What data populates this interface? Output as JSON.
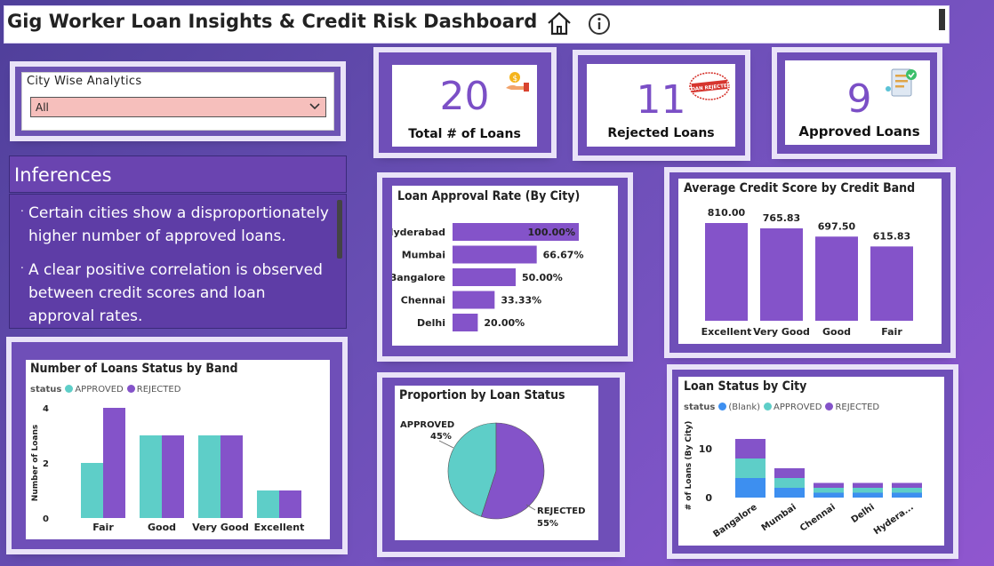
{
  "header": {
    "title": "Gig Worker Loan Insights & Credit Risk Dashboard"
  },
  "filter": {
    "label": "City Wise Analytics",
    "selected": "All"
  },
  "inferences": {
    "title": "Inferences",
    "items": [
      "Certain cities show a disproportionately higher number of approved loans.",
      "A clear positive correlation is observed between credit scores and loan approval rates."
    ]
  },
  "kpis": [
    {
      "value": "20",
      "label": "Total # of Loans",
      "icon": "money-hand-icon"
    },
    {
      "value": "11",
      "label": "Rejected Loans",
      "icon": "loan-rejected-stamp-icon",
      "stamp_text": "LOAN REJECTED"
    },
    {
      "value": "9",
      "label": "Approved Loans",
      "icon": "approved-document-icon"
    }
  ],
  "colors": {
    "purple": "#8453c9",
    "teal": "#5ecec8",
    "blue": "#3d8ff0"
  },
  "chart_data": [
    {
      "type": "bar",
      "orientation": "horizontal",
      "title": "Loan Approval Rate (By City)",
      "categories": [
        "Hyderabad",
        "Mumbai",
        "Bangalore",
        "Chennai",
        "Delhi"
      ],
      "values": [
        100.0,
        66.67,
        50.0,
        33.33,
        20.0
      ],
      "labels": [
        "100.00%",
        "66.67%",
        "50.00%",
        "33.33%",
        "20.00%"
      ]
    },
    {
      "type": "bar",
      "title": "Average Credit Score by Credit Band",
      "categories": [
        "Excellent",
        "Very Good",
        "Good",
        "Fair"
      ],
      "values": [
        810.0,
        765.83,
        697.5,
        615.83
      ],
      "labels": [
        "810.00",
        "765.83",
        "697.50",
        "615.83"
      ]
    },
    {
      "type": "bar",
      "title": "Number of Loans Status by Band",
      "legend_title": "status",
      "ylabel": "Number of Loans",
      "yticks": [
        "0",
        "2",
        "4"
      ],
      "ylim": [
        0,
        4
      ],
      "categories": [
        "Fair",
        "Good",
        "Very Good",
        "Excellent"
      ],
      "series": [
        {
          "name": "APPROVED",
          "values": [
            2,
            3,
            3,
            1
          ]
        },
        {
          "name": "REJECTED",
          "values": [
            4,
            3,
            3,
            1
          ]
        }
      ]
    },
    {
      "type": "pie",
      "title": "Proportion by Loan Status",
      "slices": [
        {
          "name": "APPROVED",
          "value": 45,
          "label": "45%"
        },
        {
          "name": "REJECTED",
          "value": 55,
          "label": "55%"
        }
      ]
    },
    {
      "type": "bar",
      "stacked": true,
      "title": "Loan Status by City",
      "legend_title": "status",
      "ylabel": "# of Loans (By City)",
      "yticks": [
        "0",
        "10"
      ],
      "categories": [
        "Bangalore",
        "Mumbai",
        "Chennai",
        "Delhi",
        "Hydera..."
      ],
      "series": [
        {
          "name": "(Blank)",
          "values": [
            4,
            2,
            1,
            1,
            1
          ]
        },
        {
          "name": "APPROVED",
          "values": [
            4,
            2,
            1,
            1,
            1
          ]
        },
        {
          "name": "REJECTED",
          "values": [
            4,
            2,
            1,
            1,
            1
          ]
        }
      ]
    }
  ]
}
